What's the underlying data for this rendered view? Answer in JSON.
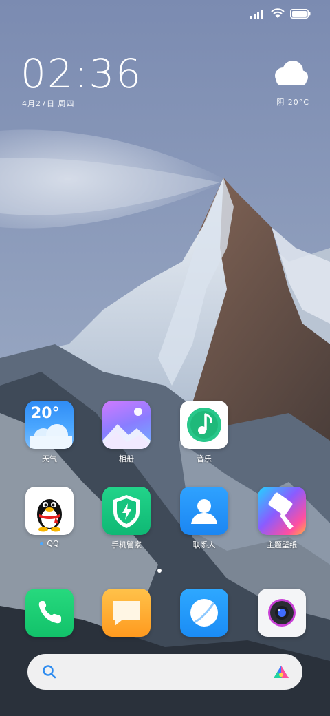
{
  "status_bar": {
    "icons": [
      "signal-icon",
      "wifi-icon",
      "battery-icon"
    ]
  },
  "clock": {
    "time": "02:36",
    "date": "4月27日 周四"
  },
  "weather_widget": {
    "icon": "cloud-icon",
    "condition": "阴 20°C"
  },
  "apps_row1": [
    {
      "label": "天气",
      "tile_text": "20°",
      "icon": "weather-app-icon"
    },
    {
      "label": "相册",
      "icon": "gallery-app-icon"
    },
    {
      "label": "音乐",
      "icon": "music-app-icon"
    }
  ],
  "apps_row2": [
    {
      "label": "QQ",
      "icon": "qq-app-icon",
      "notification": true
    },
    {
      "label": "手机管家",
      "icon": "security-app-icon"
    },
    {
      "label": "联系人",
      "icon": "contacts-app-icon"
    },
    {
      "label": "主题壁纸",
      "icon": "themes-app-icon"
    }
  ],
  "dock": [
    {
      "icon": "phone-app-icon"
    },
    {
      "icon": "messages-app-icon"
    },
    {
      "icon": "browser-app-icon"
    },
    {
      "icon": "camera-app-icon"
    }
  ],
  "pager": {
    "pages": 1,
    "current": 1
  },
  "search": {
    "icon": "search-icon",
    "brand_icon": "assistant-icon"
  }
}
